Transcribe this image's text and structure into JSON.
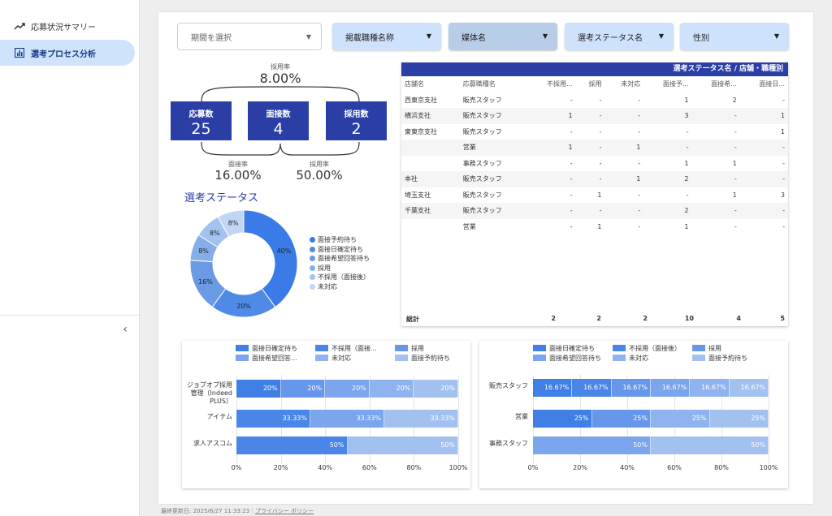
{
  "sidebar": {
    "items": [
      {
        "label": "応募状況サマリー",
        "icon": "trending-up-icon"
      },
      {
        "label": "選考プロセス分析",
        "icon": "bar-chart-icon"
      }
    ]
  },
  "filters": {
    "period": "期間を選択",
    "job_title": "掲載職種名称",
    "media": "媒体名",
    "status": "選考ステータス名",
    "gender": "性別"
  },
  "funnel": {
    "top_rate_label": "採用率",
    "top_rate_value": "8.00%",
    "kpis": [
      {
        "label": "応募数",
        "value": "25"
      },
      {
        "label": "面接数",
        "value": "4"
      },
      {
        "label": "採用数",
        "value": "2"
      }
    ],
    "interview_rate_label": "面接率",
    "interview_rate_value": "16.00%",
    "hire_rate_label": "採用率",
    "hire_rate_value": "50.00%"
  },
  "donut": {
    "title": "選考ステータス",
    "colors": [
      "#3b7be8",
      "#4f8ae6",
      "#6a9ae4",
      "#85aee9",
      "#a3c2ef",
      "#c1d6f4"
    ],
    "legend": [
      "面接予約待ち",
      "面接日確定待ち",
      "面接希望回答待ち",
      "採用",
      "不採用（面接後）",
      "未対応"
    ],
    "slices": [
      {
        "name": "面接予約待ち",
        "pct": 40,
        "label": "40%"
      },
      {
        "name": "面接日確定待ち",
        "pct": 20,
        "label": "20%"
      },
      {
        "name": "面接希望回答待ち",
        "pct": 16,
        "label": "16%"
      },
      {
        "name": "採用",
        "pct": 8,
        "label": "8%"
      },
      {
        "name": "不採用（面接後）",
        "pct": 8,
        "label": "8%"
      },
      {
        "name": "未対応",
        "pct": 8,
        "label": "8%"
      }
    ]
  },
  "table": {
    "title": "選考ステータス名 / 店舗・職種別",
    "headers": [
      "店舗名",
      "応募職種名",
      "不採用...",
      "採用",
      "未対応",
      "面接予...",
      "面接希...",
      "面接日..."
    ],
    "rows": [
      [
        "西東京支社",
        "販売スタッフ",
        "-",
        "-",
        "-",
        "1",
        "2",
        "-"
      ],
      [
        "横浜支社",
        "販売スタッフ",
        "1",
        "-",
        "-",
        "3",
        "-",
        "1"
      ],
      [
        "東東京支社",
        "販売スタッフ",
        "-",
        "-",
        "-",
        "-",
        "-",
        "1"
      ],
      [
        "",
        "営業",
        "1",
        "-",
        "1",
        "-",
        "-",
        "-"
      ],
      [
        "",
        "事務スタッフ",
        "-",
        "-",
        "-",
        "1",
        "1",
        "-"
      ],
      [
        "本社",
        "販売スタッフ",
        "-",
        "-",
        "1",
        "2",
        "-",
        "-"
      ],
      [
        "埼玉支社",
        "販売スタッフ",
        "-",
        "1",
        "-",
        "-",
        "1",
        "3"
      ],
      [
        "千葉支社",
        "販売スタッフ",
        "-",
        "-",
        "-",
        "2",
        "-",
        "-"
      ],
      [
        "",
        "営業",
        "-",
        "1",
        "-",
        "1",
        "-",
        "-"
      ]
    ],
    "total_label": "総計",
    "totals": [
      "2",
      "2",
      "2",
      "10",
      "4",
      "5"
    ]
  },
  "chart_data": [
    {
      "type": "bar",
      "orientation": "horizontal-stacked-100",
      "legend": [
        "面接日確定待ち",
        "不採用（面接...",
        "採用",
        "面接希望回答...",
        "未対応",
        "面接予約待ち"
      ],
      "legend_colors": [
        "#3f7fe6",
        "#4a86e8",
        "#6797ea",
        "#7ba5ec",
        "#8fb3ee",
        "#a3c1f0"
      ],
      "categories": [
        "ジョブオプ採用管理（Indeed PLUS）",
        "アイテム",
        "求人アスコム"
      ],
      "rows": [
        {
          "category": "ジョブオプ採用管理（Indeed PLUS）",
          "segments": [
            {
              "value": 20,
              "label": "20%",
              "color": "#3f7fe6"
            },
            {
              "value": 20,
              "label": "20%",
              "color": "#6797ea"
            },
            {
              "value": 20,
              "label": "20%",
              "color": "#7ba5ec"
            },
            {
              "value": 20,
              "label": "20%",
              "color": "#8fb3ee"
            },
            {
              "value": 20,
              "label": "20%",
              "color": "#a3c1f0"
            }
          ]
        },
        {
          "category": "アイテム",
          "segments": [
            {
              "value": 33.33,
              "label": "33.33%",
              "color": "#4a86e8"
            },
            {
              "value": 33.33,
              "label": "33.33%",
              "color": "#7ba5ec"
            },
            {
              "value": 33.33,
              "label": "33.33%",
              "color": "#a3c1f0"
            }
          ]
        },
        {
          "category": "求人アスコム",
          "segments": [
            {
              "value": 50,
              "label": "50%",
              "color": "#4a86e8"
            },
            {
              "value": 50,
              "label": "50%",
              "color": "#a3c1f0"
            }
          ]
        }
      ],
      "xticks": [
        "0%",
        "20%",
        "40%",
        "60%",
        "80%",
        "100%"
      ],
      "xlim": [
        0,
        100
      ]
    },
    {
      "type": "bar",
      "orientation": "horizontal-stacked-100",
      "legend": [
        "面接日確定待ち",
        "不採用（面接後）",
        "採用",
        "面接希望回答待ち",
        "未対応",
        "面接予約待ち"
      ],
      "legend_colors": [
        "#3f7fe6",
        "#4a86e8",
        "#6797ea",
        "#7ba5ec",
        "#8fb3ee",
        "#a3c1f0"
      ],
      "categories": [
        "販売スタッフ",
        "営業",
        "事務スタッフ"
      ],
      "rows": [
        {
          "category": "販売スタッフ",
          "segments": [
            {
              "value": 16.67,
              "label": "16.67%",
              "color": "#3f7fe6"
            },
            {
              "value": 16.67,
              "label": "16.67%",
              "color": "#4a86e8"
            },
            {
              "value": 16.67,
              "label": "16.67%",
              "color": "#6797ea"
            },
            {
              "value": 16.67,
              "label": "16.67%",
              "color": "#7ba5ec"
            },
            {
              "value": 16.67,
              "label": "16.67%",
              "color": "#8fb3ee"
            },
            {
              "value": 16.67,
              "label": "16.67%",
              "color": "#a3c1f0"
            }
          ]
        },
        {
          "category": "営業",
          "segments": [
            {
              "value": 25,
              "label": "25%",
              "color": "#3f7fe6"
            },
            {
              "value": 25,
              "label": "25%",
              "color": "#6797ea"
            },
            {
              "value": 25,
              "label": "25%",
              "color": "#8fb3ee"
            },
            {
              "value": 25,
              "label": "25%",
              "color": "#a3c1f0"
            }
          ]
        },
        {
          "category": "事務スタッフ",
          "segments": [
            {
              "value": 50,
              "label": "50%",
              "color": "#7ba5ec"
            },
            {
              "value": 50,
              "label": "50%",
              "color": "#a3c1f0"
            }
          ]
        }
      ],
      "xticks": [
        "0%",
        "20%",
        "40%",
        "60%",
        "80%",
        "100%"
      ],
      "xlim": [
        0,
        100
      ]
    }
  ],
  "footer": {
    "updated": "最終更新日: 2025/8/27 11:33:23",
    "privacy": "プライバシー ポリシー"
  }
}
